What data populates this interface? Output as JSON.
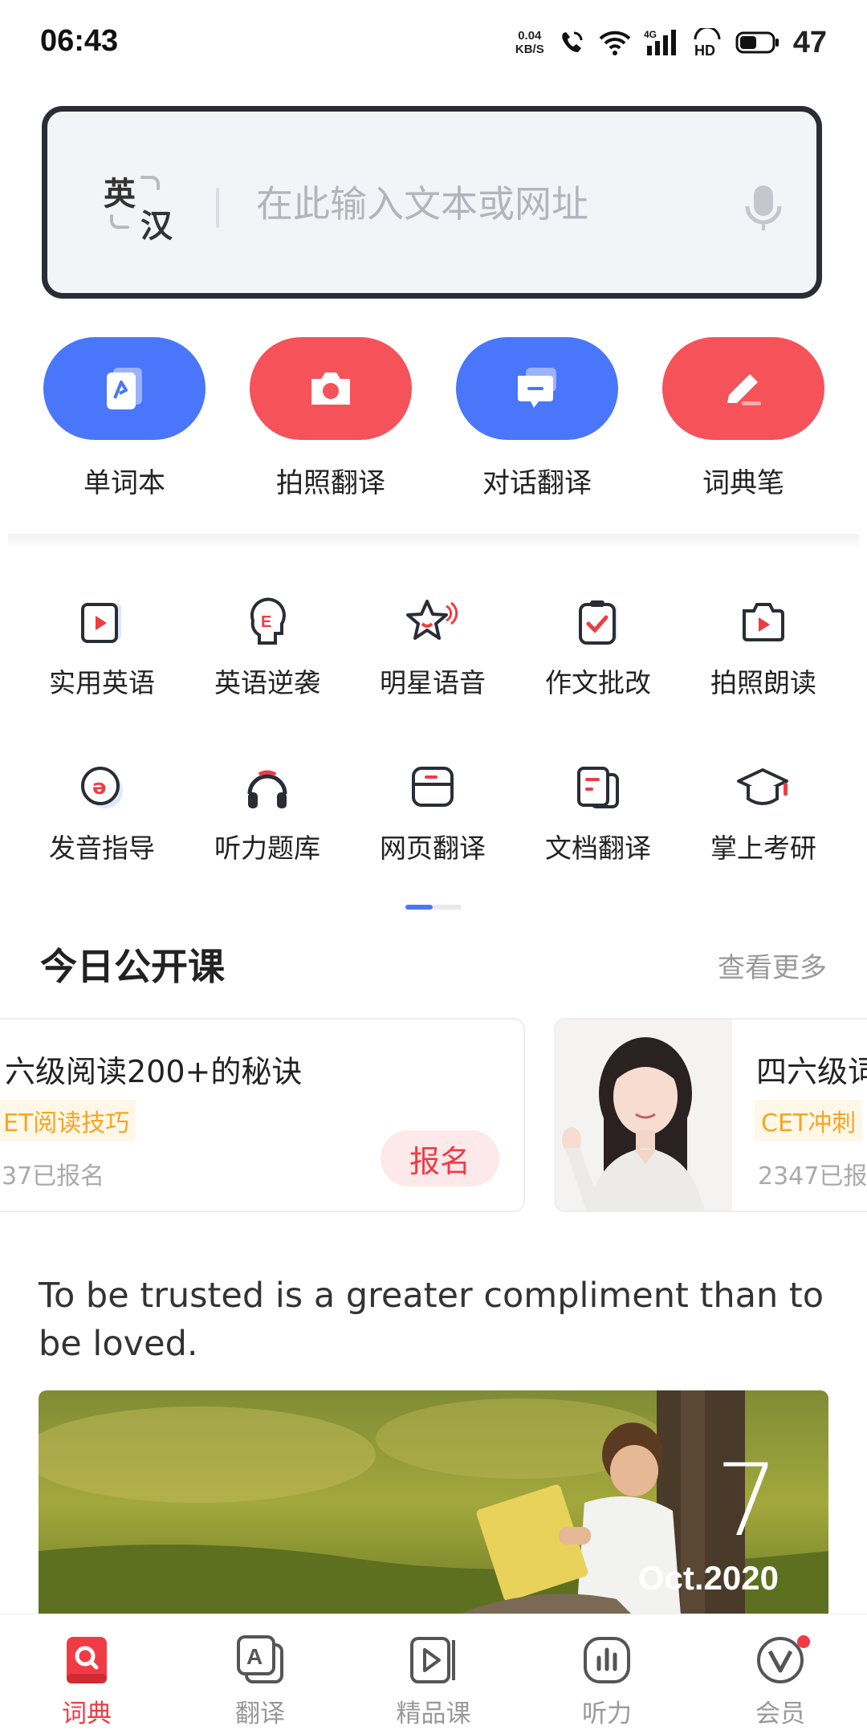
{
  "status_bar": {
    "time": "06:43",
    "net_speed_value": "0.04",
    "net_speed_unit": "KB/S",
    "signal_label": "4G",
    "hd_label": "HD",
    "battery": "47"
  },
  "search": {
    "lang_from": "英",
    "lang_to": "汉",
    "placeholder": "在此输入文本或网址"
  },
  "quick_actions": [
    {
      "label": "单词本",
      "icon": "wordbook-icon",
      "color": "#4976fb"
    },
    {
      "label": "拍照翻译",
      "icon": "camera-icon",
      "color": "#f55259"
    },
    {
      "label": "对话翻译",
      "icon": "chat-icon",
      "color": "#4976fb"
    },
    {
      "label": "词典笔",
      "icon": "pen-icon",
      "color": "#f55259"
    }
  ],
  "tools_row1": [
    {
      "label": "实用英语",
      "icon": "video-play-icon"
    },
    {
      "label": "英语逆袭",
      "icon": "head-e-icon"
    },
    {
      "label": "明星语音",
      "icon": "star-voice-icon"
    },
    {
      "label": "作文批改",
      "icon": "clipboard-check-icon"
    },
    {
      "label": "拍照朗读",
      "icon": "camera-play-icon"
    }
  ],
  "tools_row2": [
    {
      "label": "发音指导",
      "icon": "pronunciation-icon"
    },
    {
      "label": "听力题库",
      "icon": "headphones-icon"
    },
    {
      "label": "网页翻译",
      "icon": "webpage-icon"
    },
    {
      "label": "文档翻译",
      "icon": "document-icon"
    },
    {
      "label": "掌上考研",
      "icon": "graduation-cap-icon"
    }
  ],
  "open_class": {
    "title": "今日公开课",
    "see_more": "查看更多",
    "courses": [
      {
        "title": "六级阅读200+的秘诀",
        "tag": "ET阅读技巧",
        "count": "37已报名",
        "button": "报名"
      },
      {
        "title": "四六级词",
        "tag": "CET冲刺",
        "count": "2347已报"
      }
    ]
  },
  "daily": {
    "quote": "To be trusted is a greater compliment than to be loved.",
    "day": "7",
    "month_year": "Oct.2020"
  },
  "bottom_nav": [
    {
      "label": "词典",
      "icon": "dictionary-icon",
      "active": true
    },
    {
      "label": "翻译",
      "icon": "translate-icon",
      "active": false
    },
    {
      "label": "精品课",
      "icon": "course-icon",
      "active": false
    },
    {
      "label": "听力",
      "icon": "listening-icon",
      "active": false
    },
    {
      "label": "会员",
      "icon": "vip-icon",
      "active": false
    }
  ],
  "colors": {
    "accent_blue": "#4976fb",
    "accent_red": "#f55259",
    "nav_active": "#f03b45"
  }
}
